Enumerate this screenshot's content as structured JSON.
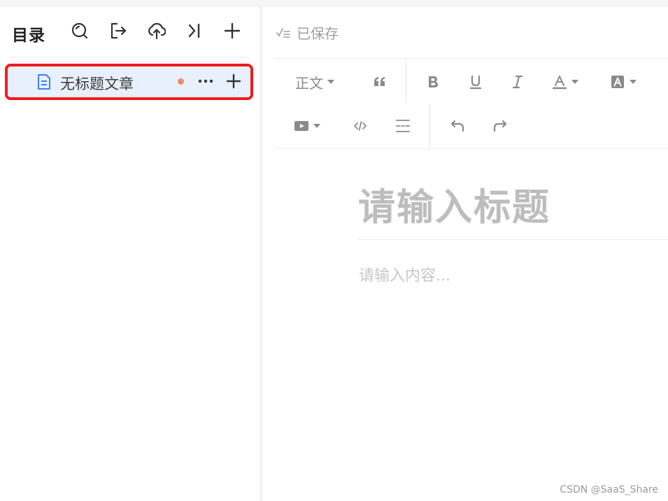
{
  "sidebar": {
    "title": "目录",
    "header_icons": [
      "search-icon",
      "export-icon",
      "upload-icon",
      "collapse-icon",
      "add-icon"
    ],
    "items": [
      {
        "label": "无标题文章",
        "icon": "document-icon",
        "unsaved": true,
        "selected": true
      }
    ]
  },
  "editor": {
    "save_status": "已保存",
    "toolbar": {
      "row1": [
        "text-style-dropdown",
        "quote-button",
        "bold-button",
        "underline-button",
        "italic-button",
        "font-color-dropdown",
        "background-color-dropdown"
      ],
      "text_style_label": "正文",
      "row2": [
        "video-dropdown",
        "code-button",
        "divider-button",
        "undo-button",
        "redo-button"
      ]
    },
    "title_placeholder": "请输入标题",
    "content_placeholder": "请输入内容..."
  },
  "watermark": "CSDN @SaaS_Share",
  "colors": {
    "selection_background": "#e8f0fe",
    "highlight_border": "#ef1c1c",
    "unsaved_dot": "#f08b6a",
    "accent_icon": "#3b82f6"
  }
}
